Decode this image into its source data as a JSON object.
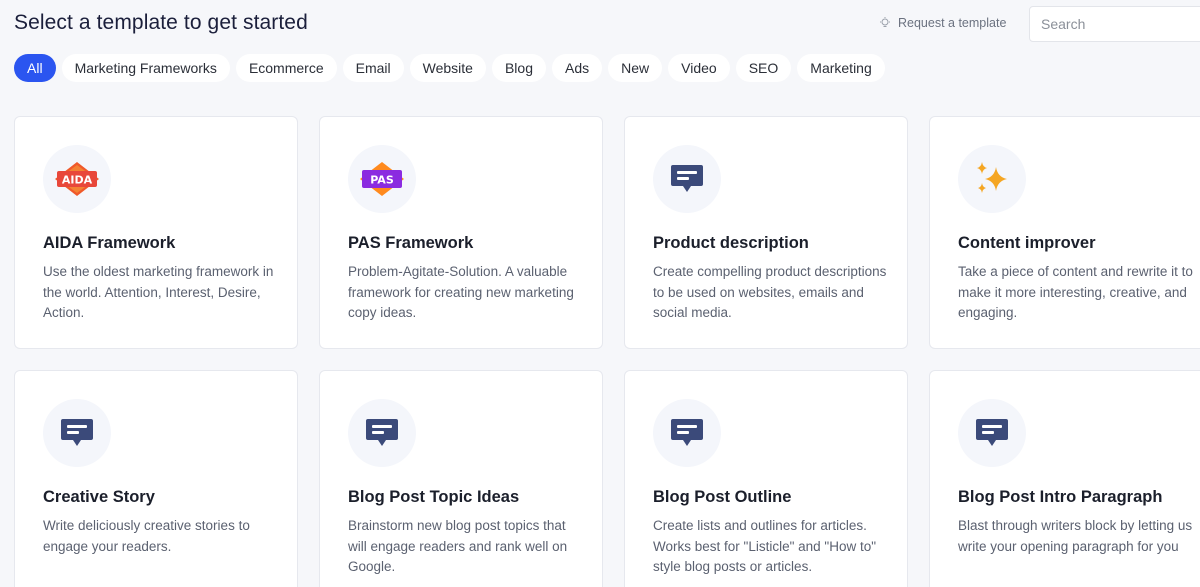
{
  "header": {
    "title": "Select a template to get started",
    "request_label": "Request a template",
    "search_placeholder": "Search"
  },
  "filters": [
    "All",
    "Marketing Frameworks",
    "Ecommerce",
    "Email",
    "Website",
    "Blog",
    "Ads",
    "New",
    "Video",
    "SEO",
    "Marketing"
  ],
  "active_filter": "All",
  "cards": [
    {
      "title": "AIDA Framework",
      "desc": "Use the oldest marketing framework in the world. Attention, Interest, Desire, Action.",
      "icon": "aida-badge-icon",
      "badge": "AIDA"
    },
    {
      "title": "PAS Framework",
      "desc": "Problem-Agitate-Solution. A valuable framework for creating new marketing copy ideas.",
      "icon": "pas-badge-icon",
      "badge": "PAS"
    },
    {
      "title": "Product description",
      "desc": "Create compelling product descriptions to be used on websites, emails and social media.",
      "icon": "chat-bubble-icon"
    },
    {
      "title": "Content improver",
      "desc": "Take a piece of content and rewrite it to make it more interesting, creative, and engaging.",
      "icon": "sparkles-icon"
    },
    {
      "title": "Creative Story",
      "desc": "Write deliciously creative stories to engage your readers.",
      "icon": "chat-bubble-icon"
    },
    {
      "title": "Blog Post Topic Ideas",
      "desc": "Brainstorm new blog post topics that will engage readers and rank well on Google.",
      "icon": "chat-bubble-icon"
    },
    {
      "title": "Blog Post Outline",
      "desc": "Create lists and outlines for articles. Works best for \"Listicle\" and \"How to\" style blog posts or articles.",
      "icon": "chat-bubble-icon"
    },
    {
      "title": "Blog Post Intro Paragraph",
      "desc": "Blast through writers block by letting us write your opening paragraph for you",
      "icon": "chat-bubble-icon"
    }
  ],
  "colors": {
    "accent": "#2b55f0",
    "icon_navy": "#3b4a7a",
    "aida_orange": "#f05a28",
    "pas_purple": "#8a2be2",
    "sparkle_orange": "#f5a623"
  }
}
